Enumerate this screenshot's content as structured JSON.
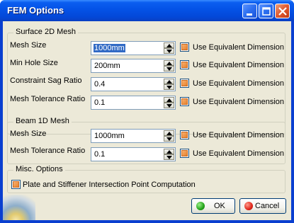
{
  "window": {
    "title": "FEM Options"
  },
  "surface2d": {
    "legend": "Surface 2D Mesh",
    "rows": [
      {
        "label": "Mesh Size",
        "value": "1000mm",
        "selected": true,
        "checkbox": "Use Equivalent Dimension"
      },
      {
        "label": "Min Hole Size",
        "value": "200mm",
        "selected": false,
        "checkbox": "Use Equivalent Dimension"
      },
      {
        "label": "Constraint Sag Ratio",
        "value": "0.4",
        "selected": false,
        "checkbox": "Use Equivalent Dimension"
      },
      {
        "label": "Mesh Tolerance Ratio",
        "value": "0.1",
        "selected": false,
        "checkbox": "Use Equivalent Dimension"
      }
    ]
  },
  "beam1d": {
    "legend": "Beam 1D Mesh",
    "rows": [
      {
        "label": "Mesh Size",
        "value": "1000mm",
        "checkbox": "Use Equivalent Dimension"
      },
      {
        "label": "Mesh Tolerance Ratio",
        "value": "0.1",
        "checkbox": "Use Equivalent Dimension"
      }
    ]
  },
  "misc": {
    "legend": "Misc. Options",
    "checkbox": "Plate and Stiffener Intersection Point Computation"
  },
  "buttons": {
    "ok": "OK",
    "cancel": "Cancel"
  }
}
